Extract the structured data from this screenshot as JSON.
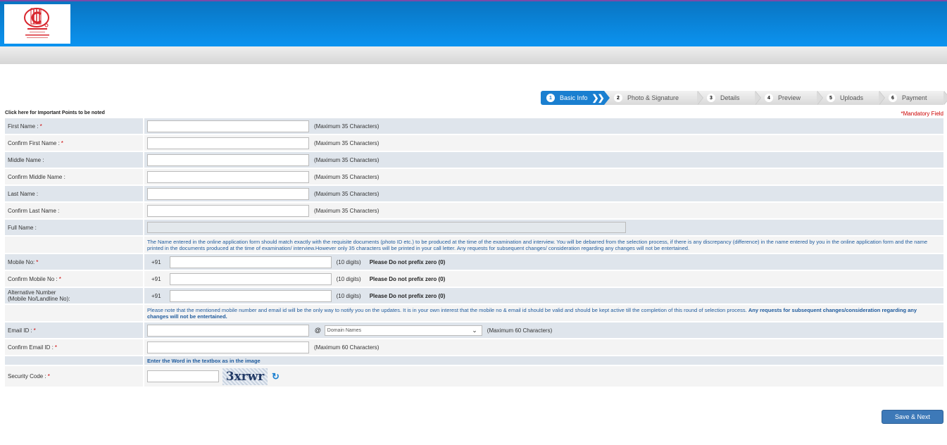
{
  "header": {
    "logo_alt": "Organization logo"
  },
  "steps": [
    {
      "num": "1",
      "label": "Basic Info",
      "active": true
    },
    {
      "num": "2",
      "label": "Photo & Signature"
    },
    {
      "num": "3",
      "label": "Details"
    },
    {
      "num": "4",
      "label": "Preview"
    },
    {
      "num": "5",
      "label": "Uploads"
    },
    {
      "num": "6",
      "label": "Payment"
    }
  ],
  "important_link": "Click here for Important Points to be noted",
  "mandatory_note": "*Mandatory Field",
  "fields": {
    "first_name": {
      "label": "First Name :",
      "required": "*",
      "value": "",
      "hint": "(Maximum 35 Characters)"
    },
    "confirm_first_name": {
      "label": "Confirm First Name :",
      "required": "*",
      "value": "",
      "hint": "(Maximum 35 Characters)"
    },
    "middle_name": {
      "label": "Middle Name :",
      "value": "",
      "hint": "(Maximum 35 Characters)"
    },
    "confirm_middle_name": {
      "label": "Confirm Middle Name :",
      "value": "",
      "hint": "(Maximum 35 Characters)"
    },
    "last_name": {
      "label": "Last Name :",
      "value": "",
      "hint": "(Maximum 35 Characters)"
    },
    "confirm_last_name": {
      "label": "Confirm Last Name :",
      "value": "",
      "hint": "(Maximum 35 Characters)"
    },
    "full_name": {
      "label": "Full Name :",
      "value": ""
    },
    "name_note": "The Name entered in the online application form should match exactly with the requisite documents (photo ID etc.) to be produced at the time of the examination and interview. You will be debarred from the selection process, if there is any discrepancy (difference) in the name entered by you in the online application form and the name printed in the documents produced at the time of examination/ interview.However only 35 characters will be printed in your call letter. Any requests for subsequent changes/ consideration regarding any changes will not be entertained.",
    "mobile": {
      "label": "Mobile No:",
      "required": "*",
      "prefix": "+91",
      "value": "",
      "hint": "(10 digits)",
      "warning": "Please Do not prefix zero (0)"
    },
    "confirm_mobile": {
      "label": "Confirm Mobile No :",
      "required": "*",
      "prefix": "+91",
      "value": "",
      "hint": "(10 digits)",
      "warning": "Please Do not prefix zero (0)"
    },
    "alt_number": {
      "label_line1": "Alternative Number",
      "label_line2": "(Mobile No/Landline No):",
      "prefix": "+91",
      "value": "",
      "hint": "(10 digits)",
      "warning": "Please Do not prefix zero (0)"
    },
    "contact_note": "Please note that the mentioned mobile number and email id will be the only way to notify you on the updates. It is in your own interest that the mobile no & email id should be valid and should be kept active till the completion of this round of selection process.",
    "contact_note_bold": "Any requests for subsequent changes/consideration regarding any changes will not be entertained.",
    "email": {
      "label": "Email ID :",
      "required": "*",
      "value": "",
      "at": "@",
      "domain_selected": "Domain Names",
      "hint": "(Maximum 60 Characters)"
    },
    "confirm_email": {
      "label": "Confirm Email ID :",
      "required": "*",
      "value": "",
      "hint": "(Maximum 60 Characters)"
    },
    "captcha_instruction": "Enter the Word in the textbox as in the image",
    "security_code": {
      "label": "Security Code :",
      "required": "*",
      "value": "",
      "captcha_text": "3xrwr"
    }
  },
  "buttons": {
    "save_next": "Save & Next"
  },
  "colors": {
    "header_blue": "#0b93f0",
    "active_step": "#1a7fd0",
    "required": "#cc0000",
    "button": "#3d79b8"
  }
}
